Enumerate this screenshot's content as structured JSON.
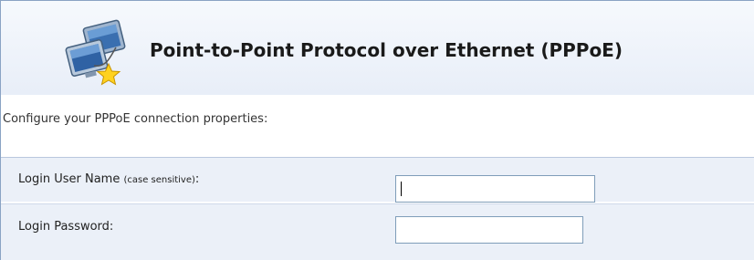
{
  "header": {
    "title": "Point-to-Point Protocol over Ethernet (PPPoE)",
    "icon": "network-computers-icon"
  },
  "intro": "Configure your PPPoE connection properties:",
  "form": {
    "username": {
      "label": "Login User Name",
      "note": "(case sensitive)",
      "suffix": ":",
      "value": ""
    },
    "password": {
      "label": "Login Password:",
      "value": ""
    }
  },
  "colors": {
    "border": "#8aa3c4",
    "row_background": "#ebf0f8",
    "field_border": "#7f9db9"
  }
}
